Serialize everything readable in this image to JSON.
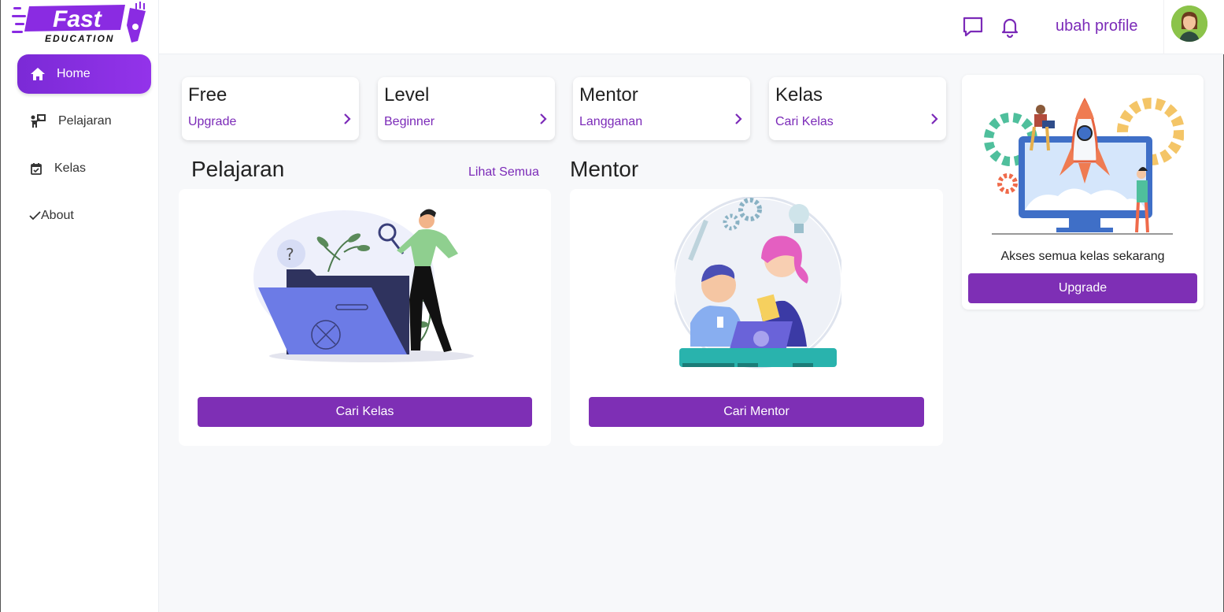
{
  "brand": {
    "name": "Fast",
    "tagline": "EDUCATION"
  },
  "sidebar": {
    "items": [
      {
        "label": "Home",
        "icon": "home-icon",
        "active": true
      },
      {
        "label": "Pelajaran",
        "icon": "teacher-board-icon",
        "active": false
      },
      {
        "label": "Kelas",
        "icon": "calendar-check-icon",
        "active": false
      },
      {
        "label": "About",
        "icon": "check-icon",
        "active": false
      }
    ]
  },
  "header": {
    "profile_link": "ubah profile",
    "icons": [
      "chat-icon",
      "bell-icon",
      "avatar"
    ]
  },
  "stats": [
    {
      "title": "Free",
      "subtitle": "Upgrade"
    },
    {
      "title": "Level",
      "subtitle": "Beginner"
    },
    {
      "title": "Mentor",
      "subtitle": "Langganan"
    },
    {
      "title": "Kelas",
      "subtitle": "Cari Kelas"
    }
  ],
  "pelajaran": {
    "title": "Pelajaran",
    "see_all": "Lihat Semua",
    "button": "Cari Kelas"
  },
  "mentor": {
    "title": "Mentor",
    "button": "Cari Mentor"
  },
  "promo": {
    "text": "Akses semua kelas sekarang",
    "button": "Upgrade"
  },
  "colors": {
    "accent": "#7e2fb5",
    "accent_light": "#9333ea",
    "background": "#f7f8fa"
  }
}
